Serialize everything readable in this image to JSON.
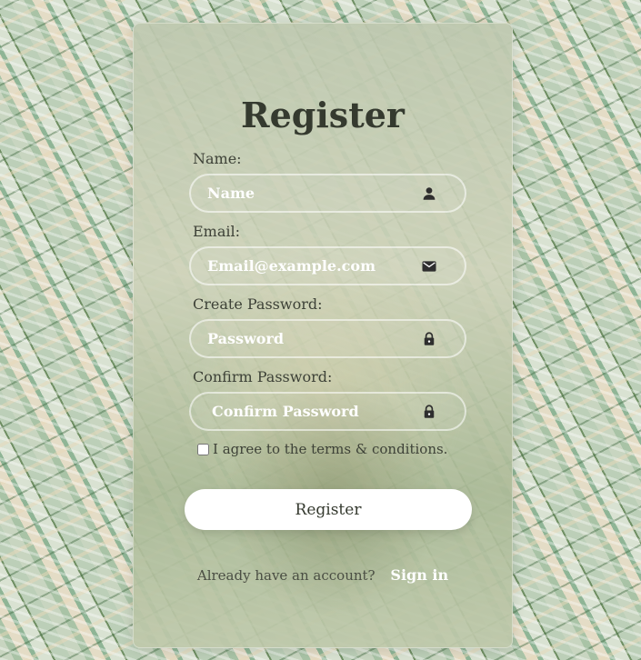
{
  "form": {
    "title": "Register",
    "name_label": "Name:",
    "name_placeholder": "Name",
    "email_label": "Email:",
    "email_placeholder": "Email@example.com",
    "password_label": "Create Password:",
    "password_placeholder": "Password",
    "confirm_label": "Confirm Password:",
    "confirm_placeholder": "Confirm Password",
    "terms_text": "I agree to the terms & conditions.",
    "register_label": "Register",
    "account_prompt": "Already have an account?",
    "signin_label": "Sign in"
  },
  "icons": {
    "name": "person-icon",
    "email": "envelope-icon",
    "password": "lock-icon",
    "confirm": "lock-icon"
  },
  "colors": {
    "text_dark": "#353a2f",
    "field_text": "#ffffff",
    "button_bg": "#ffffff"
  }
}
